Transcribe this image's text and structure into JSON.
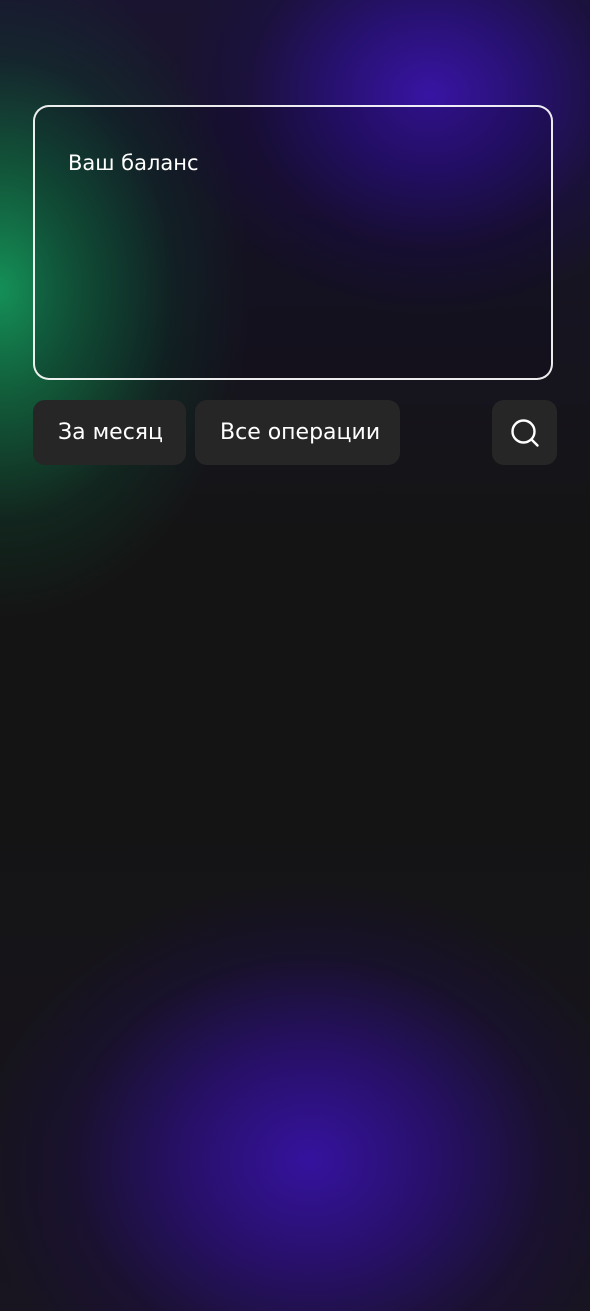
{
  "balance_card": {
    "label": "Ваш баланс"
  },
  "filters": {
    "period_label": "За месяц",
    "operations_label": "Все операции"
  },
  "search": {
    "icon": "search-icon"
  },
  "colors": {
    "background": "#141414",
    "chip_background": "#262626",
    "accent_green": "#14965A",
    "accent_purple": "#3A14AA",
    "text": "#ffffff"
  }
}
